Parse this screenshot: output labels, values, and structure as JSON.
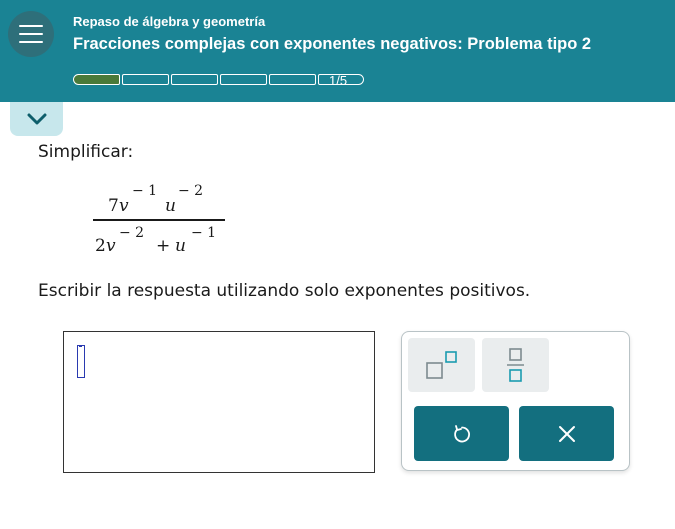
{
  "header": {
    "topic": "Repaso de álgebra y geometría",
    "title": "Fracciones complejas con exponentes negativos: Problema tipo 2",
    "progress_text": "1/5",
    "progress_fraction": 0.2,
    "background_color": "#1a8394"
  },
  "question": {
    "prompt": "Simplificar:",
    "numerator": {
      "coef": "7",
      "var1": "v",
      "exp1": "− 1",
      "var2": "u",
      "exp2": "− 2"
    },
    "denominator": {
      "coef": "2",
      "var1": "v",
      "exp1": "− 2",
      "plus": "+",
      "var2": "u",
      "exp2": "− 1"
    },
    "instructions": "Escribir la respuesta utilizando solo exponentes positivos."
  },
  "keypad": {
    "keys": [
      {
        "name": "superscript-key",
        "icon": "superscript-icon"
      },
      {
        "name": "fraction-key",
        "icon": "fraction-icon"
      },
      {
        "name": "undo-key",
        "icon": "undo-icon"
      },
      {
        "name": "clear-key",
        "icon": "close-icon"
      }
    ],
    "accent_color": "#136f7f",
    "icon_color": "#1a9bb0"
  }
}
